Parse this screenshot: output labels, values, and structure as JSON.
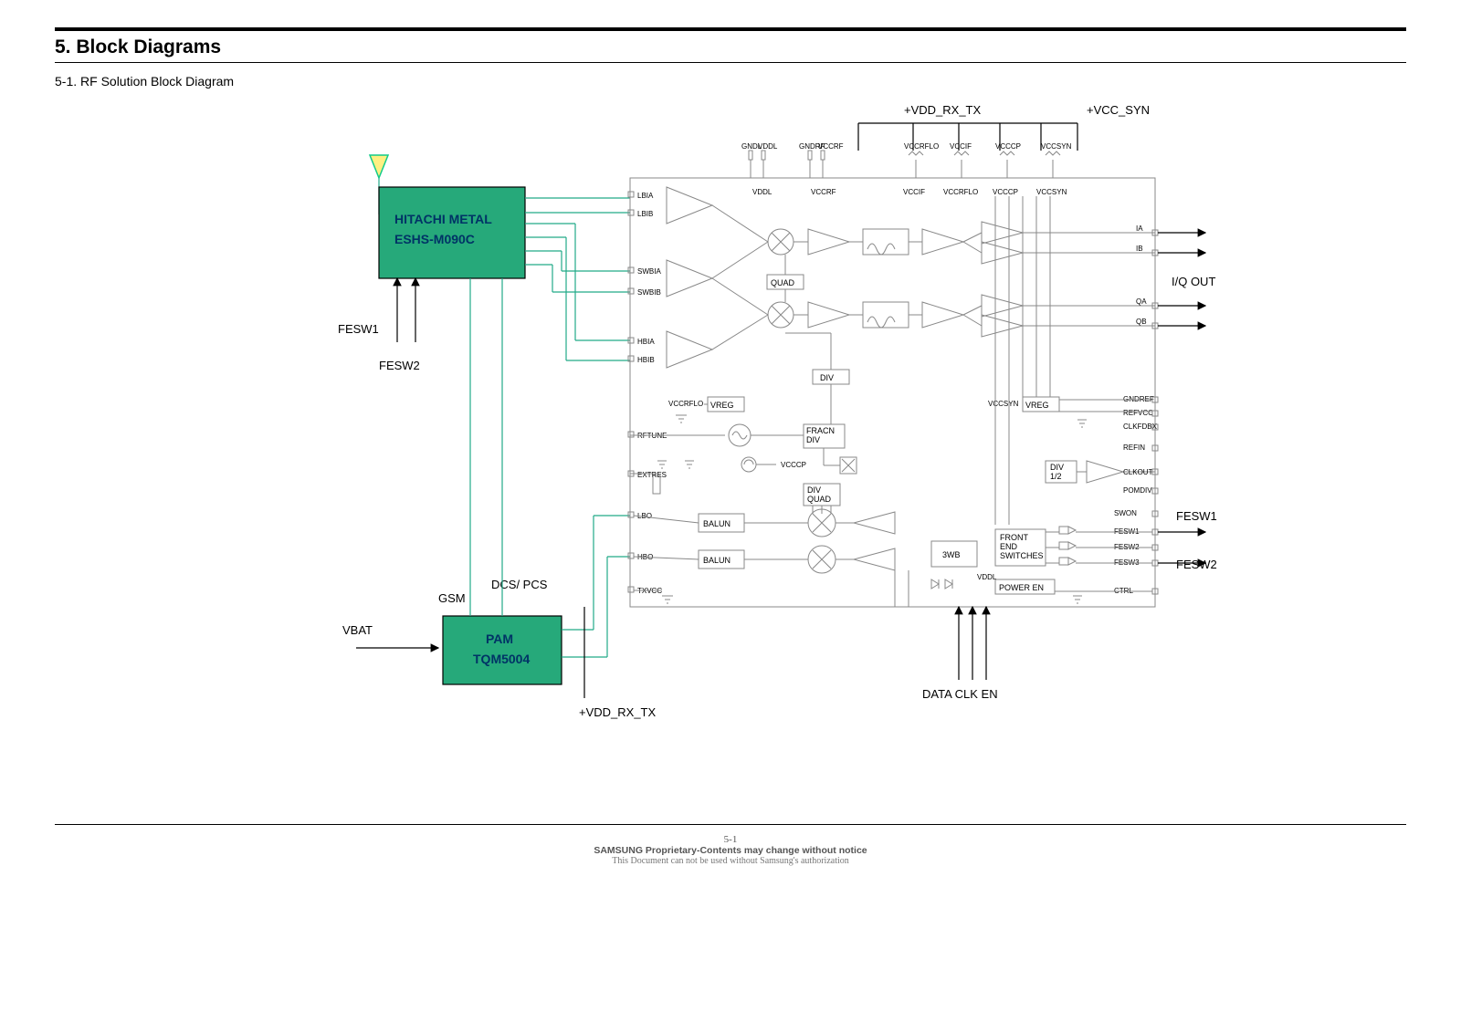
{
  "section_title": "5. Block Diagrams",
  "subsection_title": "5-1.  RF  Solution  Block  Diagram",
  "top_rails": {
    "left": "+VDD_RX_TX",
    "right": "+VCC_SYN"
  },
  "blocks": {
    "fem": {
      "line1": "HITACHI METAL",
      "line2": "ESHS-M090C"
    },
    "pam": {
      "line1": "PAM",
      "line2": "TQM5004"
    }
  },
  "left_side_labels": {
    "fesw1": "FESW1",
    "fesw2": "FESW2",
    "vbat": "VBAT",
    "gsm": "GSM",
    "dcs_pcs": "DCS/\nPCS"
  },
  "bottom_labels": {
    "vdd_rx_tx": "+VDD_RX_TX",
    "data_clk_en": "DATA CLK EN"
  },
  "right_side_labels": {
    "iq_out": "I/Q OUT",
    "fesw1": "FESW1",
    "fesw2": "FESW2"
  },
  "chip_top_caps": [
    "GNDL",
    "VDDL",
    "GNDRF",
    "VCCRF",
    "VCCRFLO",
    "VCCIF",
    "VCCCP",
    "VCCSYN"
  ],
  "chip_top_inner": [
    "VDDL",
    "VCCRF",
    "VCCIF",
    "VCCRFLO",
    "VCCCP",
    "VCCSYN"
  ],
  "chip_left_ports": [
    "LBIA",
    "LBIB",
    "SWBIA",
    "SWBIB",
    "HBIA",
    "HBIB",
    "RFTUNE",
    "EXTRES",
    "LBO",
    "HBO",
    "TXVCC"
  ],
  "chip_right_ports_top": [
    "IA",
    "IB",
    "QA",
    "QB"
  ],
  "chip_right_ports_mid": [
    "GNDREF",
    "REFVCC",
    "CLKFDBX",
    "REFIN",
    "CLKOUT",
    "POMDIV"
  ],
  "chip_right_ports_bot": [
    "SWON",
    "FESW1",
    "FESW2",
    "FESW3",
    "CTRL"
  ],
  "chip_inner_boxes": {
    "quad": "QUAD",
    "div": "DIV",
    "vreg1": "VREG",
    "vreg2": "VREG",
    "fracn_div": "FRACN\nDIV",
    "div_quad": "DIV\nQUAD",
    "balun1": "BALUN",
    "balun2": "BALUN",
    "three_wb": "3WB",
    "front_end_sw": "FRONT\nEND\nSWITCHES",
    "power_en": "POWER EN",
    "div12": "DIV\n1/2"
  },
  "chip_inner_labels": {
    "vccrflo": "VCCRFLO",
    "vccsyn": "VCCSYN",
    "vcccp": "VCCCP",
    "vddl": "VDDL"
  },
  "footer": {
    "page_no": "5-1",
    "l2": "SAMSUNG Proprietary-Contents may change without notice",
    "l3": "This Document can not  be  used  without  Samsung's  authorization"
  }
}
